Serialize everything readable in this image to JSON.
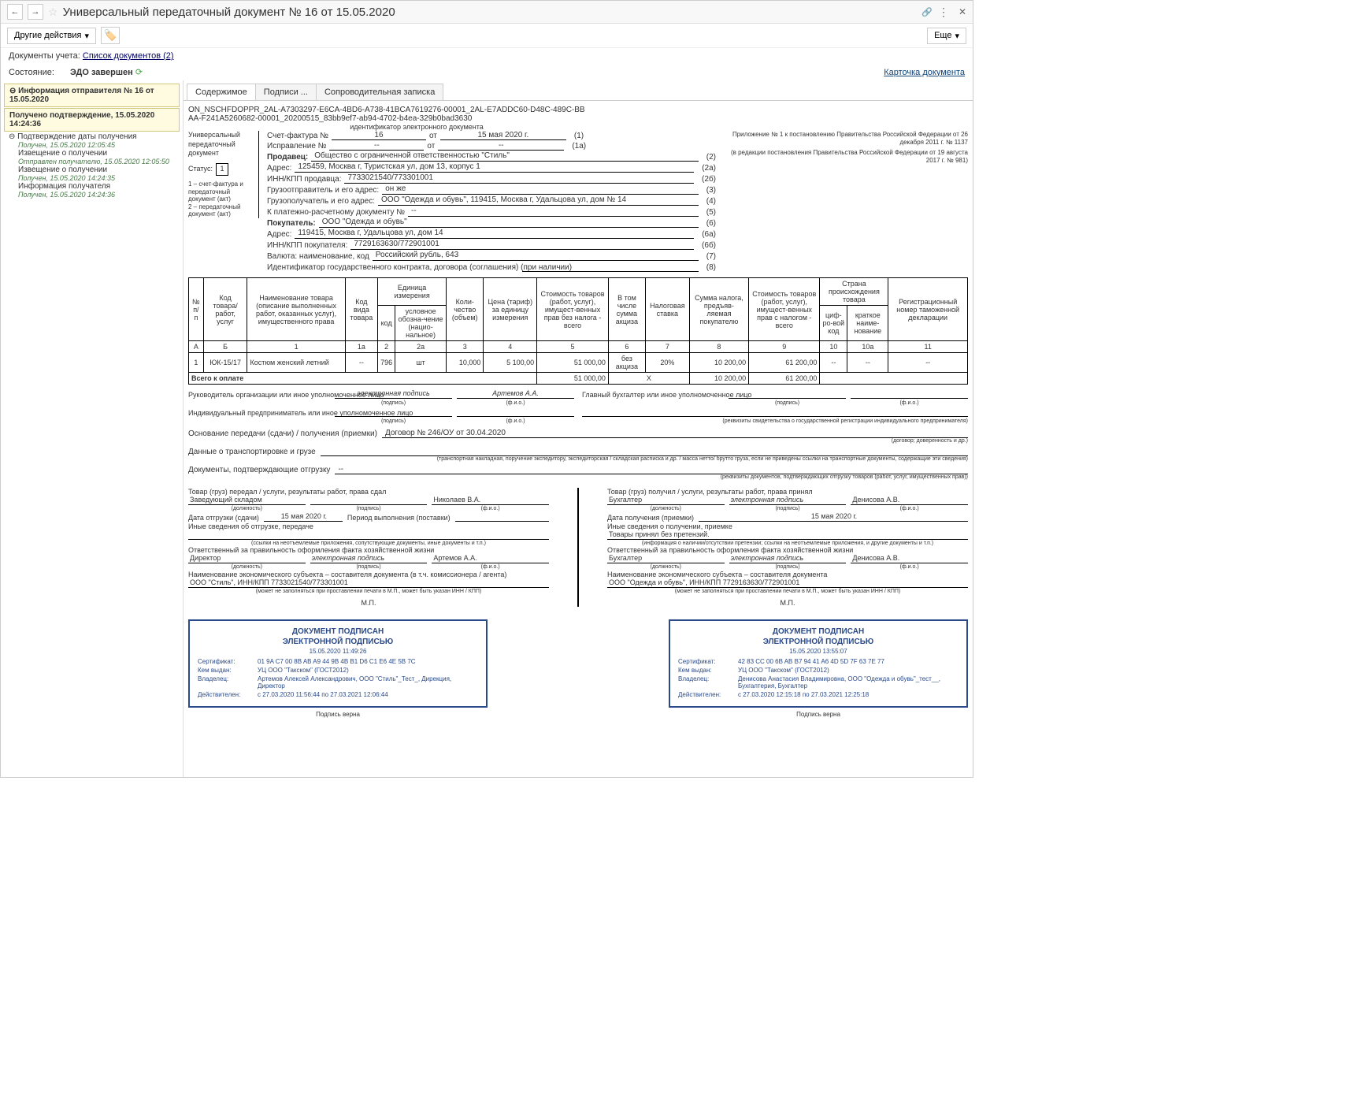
{
  "title": "Универсальный передаточный документ № 16 от 15.05.2020",
  "toolbar": {
    "other_actions": "Другие действия",
    "more": "Еще"
  },
  "docs_accounting": {
    "label": "Документы учета:",
    "link": "Список документов (2)"
  },
  "state": {
    "label": "Состояние:",
    "value": "ЭДО завершен",
    "card_link": "Карточка документа"
  },
  "sidebar": {
    "info_sender": "Информация отправителя № 16 от 15.05.2020",
    "confirm_received": "Получено подтверждение, 15.05.2020 14:24:36",
    "confirm_date": "Подтверждение даты получения",
    "rec1_meta": "Получен, 15.05.2020 12:05:45",
    "notice1": "Извещение о получении",
    "notice1_meta": "Отправлен получателю, 15.05.2020 12:05:50",
    "notice2": "Извещение о получении",
    "notice2_meta": "Получен, 15.05.2020 14:24:35",
    "recipient_info": "Информация получателя",
    "recipient_meta": "Получен, 15.05.2020 14:24:36"
  },
  "tabs": {
    "content": "Содержимое",
    "signatures": "Подписи ...",
    "cover": "Сопроводительная записка"
  },
  "doc_id": {
    "line1": "ON_NSCHFDOPPR_2AL-A7303297-E6CA-4BD6-A738-41BCA7619276-00001_2AL-E7ADDC60-D48C-489C-BB",
    "line2": "AA-F241A5260682-00001_20200515_83bb9ef7-ab94-4702-b4ea-329b0bad3630",
    "caption": "идентификатор электронного документа"
  },
  "upd_left": {
    "title": "Универсальный передаточный документ",
    "status_lbl": "Статус:",
    "status_val": "1",
    "note1": "1 – счет-фактура и передаточный документ (акт)",
    "note2": "2 – передаточный документ (акт)"
  },
  "appendix": {
    "l1": "Приложение № 1 к постановлению Правительства Российской Федерации от 26 декабря 2011 г. № 1137",
    "l2": "(в редакции постановления Правительства Российской Федерации от 19 августа 2017 г. № 981)"
  },
  "invoice": {
    "sf_lbl": "Счет-фактура №",
    "sf_no": "16",
    "sf_ot": "от",
    "sf_date": "15 мая 2020 г.",
    "sf_code": "(1)",
    "fix_lbl": "Исправление №",
    "fix_no": "--",
    "fix_date": "--",
    "fix_code": "(1а)",
    "seller_lbl": "Продавец:",
    "seller_val": "Общество с ограниченной ответственностью \"Стиль\"",
    "seller_code": "(2)",
    "addr_lbl": "Адрес:",
    "addr_val": "125459, Москва г, Туристская ул, дом 13, корпус 1",
    "addr_code": "(2а)",
    "inn_s_lbl": "ИНН/КПП продавца:",
    "inn_s_val": "7733021540/773301001",
    "inn_s_code": "(2б)",
    "shipper_lbl": "Грузоотправитель и его адрес:",
    "shipper_val": "он же",
    "shipper_code": "(3)",
    "consignee_lbl": "Грузополучатель и его адрес:",
    "consignee_val": "ООО \"Одежда и обувь\", 119415, Москва г, Удальцова ул, дом № 14",
    "consignee_code": "(4)",
    "paydoc_lbl": "К платежно-расчетному документу №",
    "paydoc_val": "--",
    "paydoc_code": "(5)",
    "buyer_lbl": "Покупатель:",
    "buyer_val": "ООО \"Одежда и обувь\"",
    "buyer_code": "(6)",
    "baddr_lbl": "Адрес:",
    "baddr_val": "119415, Москва г, Удальцова ул, дом 14",
    "baddr_code": "(6а)",
    "binn_lbl": "ИНН/КПП покупателя:",
    "binn_val": "7729163630/772901001",
    "binn_code": "(6б)",
    "curr_lbl": "Валюта: наименование, код",
    "curr_val": "Российский рубль, 643",
    "curr_code": "(7)",
    "cid_lbl": "Идентификатор государственного контракта, договора (соглашения) (при наличии)",
    "cid_val": "",
    "cid_code": "(8)"
  },
  "table_head": {
    "a": "№ п/п",
    "b": "Код товара/ работ, услуг",
    "c1": "Наименование товара (описание выполненных работ, оказанных услуг), имущественного права",
    "c1a": "Код вида товара",
    "c2h": "Единица измерения",
    "c2a": "код",
    "c2b": "условное обозна-чение (нацио-нальное)",
    "c3": "Коли-чество (объем)",
    "c4": "Цена (тариф) за единицу измерения",
    "c5": "Стоимость товаров (работ, услуг), имущест-венных прав без налога - всего",
    "c6": "В том числе сумма акциза",
    "c7": "Налоговая ставка",
    "c8": "Сумма налога, предъяв-ляемая покупателю",
    "c9": "Стоимость товаров (работ, услуг), имущест-венных прав с налогом - всего",
    "c10h": "Страна происхождения товара",
    "c10a": "циф-ро-вой код",
    "c10b": "краткое наиме-нование",
    "c11": "Регистрационный номер таможенной декларации",
    "rA": "А",
    "rB": "Б",
    "r1": "1",
    "r1a": "1а",
    "r2": "2",
    "r2a": "2а",
    "r3": "3",
    "r4": "4",
    "r5": "5",
    "r6": "6",
    "r7": "7",
    "r8": "8",
    "r9": "9",
    "r10": "10",
    "r10a": "10a",
    "r11": "11"
  },
  "row1": {
    "n": "1",
    "kod": "ЮК-15/17",
    "name": "Костюм женский летний",
    "kvid": "--",
    "ucode": "796",
    "uname": "шт",
    "qty": "10,000",
    "price": "5 100,00",
    "cost": "51 000,00",
    "akc": "без акциза",
    "rate": "20%",
    "tax": "10 200,00",
    "total": "61 200,00",
    "ccode": "--",
    "cname": "--",
    "decl": "--"
  },
  "totals": {
    "lbl": "Всего к оплате",
    "cost": "51 000,00",
    "x": "Х",
    "tax": "10 200,00",
    "total": "61 200,00"
  },
  "sig": {
    "head_lbl": "Руководитель организации или иное уполномоченное лицо",
    "esig": "электронная подпись",
    "head_name": "Артемов А.А.",
    "acc_lbl": "Главный бухгалтер или иное уполномоченное лицо",
    "ip_lbl": "Индивидуальный предприниматель или иное уполномоченное лицо",
    "podpis": "(подпись)",
    "fio": "(ф.и.о.)",
    "rekv": "(реквизиты свидетельства о государственной регистрации индивидуального предпринимателя)"
  },
  "basis": {
    "lbl": "Основание передачи (сдачи) / получения (приемки)",
    "val": "Договор № 246/ОУ от 30.04.2020",
    "cap": "(договор; доверенность и др.)"
  },
  "transport": {
    "lbl": "Данные о транспортировке и грузе",
    "cap": "(транспортная накладная, поручение экспедитору, экспедиторская / складская расписка и др. / масса нетто/ брутто груза, если не приведены ссылки на транспортные документы, содержащие эти сведения)"
  },
  "docs_ship": {
    "lbl": "Документы, подтверждающие отгрузку",
    "val": "--",
    "cap": "(реквизиты документов, подтверждающих отгрузку товаров (работ, услуг, имущественных прав))"
  },
  "left_col": {
    "h": "Товар (груз) передал / услуги, результаты работ, права сдал",
    "pos": "Заведующий складом",
    "name": "Николаев В.А.",
    "date_lbl": "Дата отгрузки (сдачи)",
    "date": "15 мая 2020 г.",
    "period": "Период выполнения (поставки)",
    "other_lbl": "Иные сведения об отгрузке, передаче",
    "other_cap": "(ссылки на неотъемлемые приложения, сопутствующие документы, иные документы и т.п.)",
    "resp_lbl": "Ответственный за правильность оформления факта хозяйственной жизни",
    "resp_pos": "Директор",
    "resp_name": "Артемов А.А.",
    "econ_lbl": "Наименование экономического субъекта – составителя документа (в т.ч. комиссионера / агента)",
    "econ_val": "ООО \"Стиль\", ИНН/КПП 7733021540/773301001",
    "econ_cap": "(может не заполняться при проставлении печати в М.П., может быть указан ИНН / КПП)",
    "mp": "М.П."
  },
  "right_col": {
    "h": "Товар (груз) получил / услуги, результаты работ, права принял",
    "pos": "Бухгалтер",
    "name": "Денисова А.В.",
    "date_lbl": "Дата получения (приемки)",
    "date": "15 мая 2020 г.",
    "other_lbl": "Иные сведения о получении, приемке",
    "claims": "Товары принял без претензий.",
    "claims_cap": "(информация о наличии/отсутствии претензии; ссылки на неотъемлемые приложения, и другие документы и т.п.)",
    "resp_lbl": "Ответственный за правильность оформления факта хозяйственной жизни",
    "resp_pos": "Бухгалтер",
    "resp_name": "Денисова А.В.",
    "econ_lbl": "Наименование экономического субъекта – составителя документа",
    "econ_val": "ООО \"Одежда и обувь\", ИНН/КПП 7729163630/772901001",
    "econ_cap": "(может не заполняться при проставлении печати в М.П., может быть указан ИНН / КПП)",
    "mp": "М.П."
  },
  "caps": {
    "dolzh": "(должность)",
    "podpis": "(подпись)",
    "fio": "(ф.и.о.)"
  },
  "stamp1": {
    "hd1": "ДОКУМЕНТ ПОДПИСАН",
    "hd2": "ЭЛЕКТРОННОЙ ПОДПИСЬЮ",
    "date": "15.05.2020 11:49:26",
    "k1": "Сертификат:",
    "v1": "01 9A C7 00 8B AB A9 44 9B 4B B1 D6 C1 E6 4E 5B 7C",
    "k2": "Кем выдан:",
    "v2": "УЦ ООО \"Такском\" (ГОСТ2012)",
    "k3": "Владелец:",
    "v3": "Артемов Алексей Александрович, ООО \"Стиль\"_Тест_, Дирекция, Директор",
    "k4": "Действителен:",
    "v4": "с 27.03.2020 11:56:44 по 27.03.2021 12:06:44",
    "verify": "Подпись верна"
  },
  "stamp2": {
    "hd1": "ДОКУМЕНТ ПОДПИСАН",
    "hd2": "ЭЛЕКТРОННОЙ ПОДПИСЬЮ",
    "date": "15.05.2020 13:55:07",
    "k1": "Сертификат:",
    "v1": "42 83 CC 00 6B AB B7 94 41 A6 4D 5D 7F 63 7E 77",
    "k2": "Кем выдан:",
    "v2": "УЦ ООО \"Такском\" (ГОСТ2012)",
    "k3": "Владелец:",
    "v3": "Денисова Анастасия Владимировна, ООО \"Одежда и обувь\"_тест__, Бухгалтерия, Бухгалтер",
    "k4": "Действителен:",
    "v4": "с 27.03.2020 12:15:18 по 27.03.2021 12:25:18",
    "verify": "Подпись верна"
  }
}
